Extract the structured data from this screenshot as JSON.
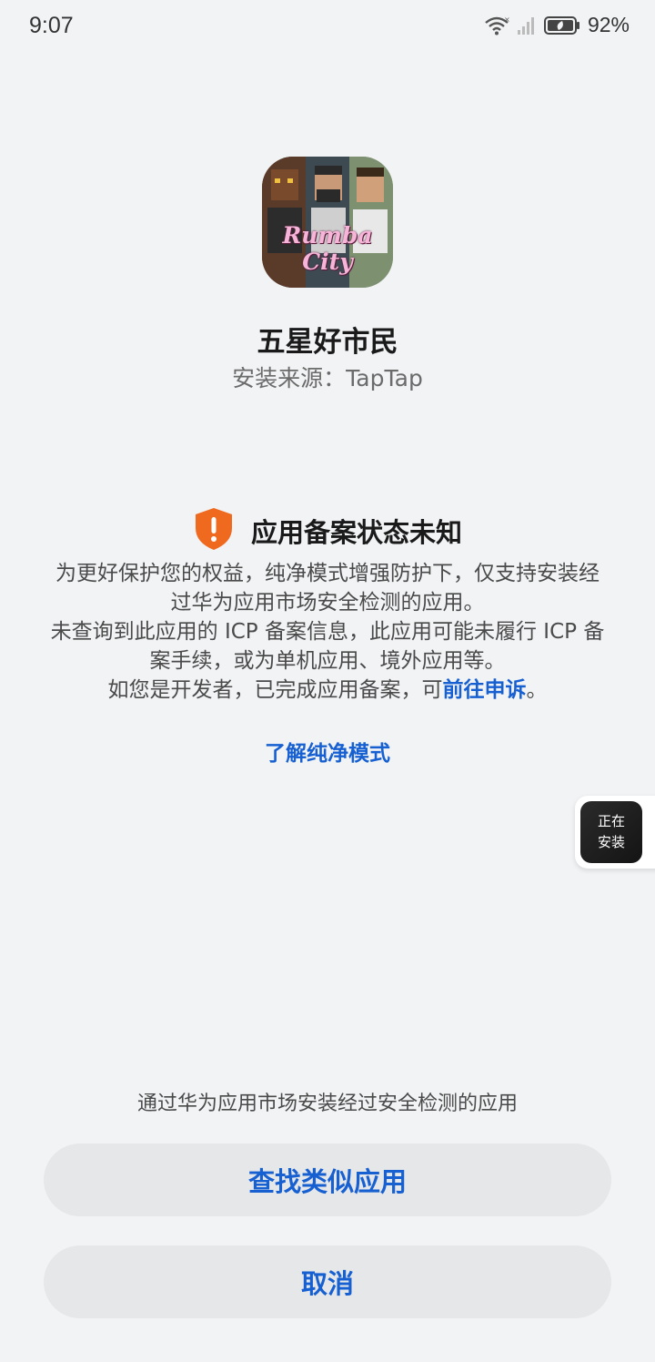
{
  "status_bar": {
    "time": "9:07",
    "battery": "92%",
    "icons": [
      "wifi-icon",
      "signal-icon",
      "battery-icon"
    ]
  },
  "app": {
    "icon_text": "Rumba City",
    "name": "五星好市民",
    "install_source": "安装来源：TapTap"
  },
  "warning": {
    "icon": "shield-alert-icon",
    "title": "应用备案状态未知",
    "line1": "为更好保护您的权益，纯净模式增强防护下，仅支持安装经过华为应用市场安全检测的应用。",
    "line2": "未查询到此应用的 ICP 备案信息，此应用可能未履行 ICP 备案手续，或为单机应用、境外应用等。",
    "line3_prefix": "如您是开发者，已完成应用备案，可",
    "line3_link": "前往申诉",
    "line3_suffix": "。",
    "learn_more": "了解纯净模式"
  },
  "float_bubble": {
    "line1": "正在",
    "line2": "安装"
  },
  "bottom": {
    "hint": "通过华为应用市场安装经过安全检测的应用",
    "find_similar": "查找类似应用",
    "cancel": "取消"
  },
  "colors": {
    "background": "#f1f3f5",
    "accent": "#1760d2",
    "warning": "#ef6a1f",
    "button_bg": "#e5e7e9"
  }
}
